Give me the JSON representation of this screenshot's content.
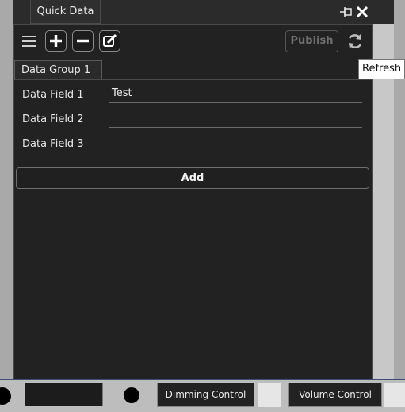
{
  "window": {
    "tab_title": "Quick Data",
    "pin_icon": "pin-icon",
    "close_icon": "close-icon"
  },
  "toolbar": {
    "menu_icon": "hamburger-menu-icon",
    "add_icon": "plus-icon",
    "remove_icon": "minus-icon",
    "edit_icon": "edit-icon",
    "publish_label": "Publish",
    "refresh_icon": "refresh-icon",
    "refresh_tooltip": "Refresh"
  },
  "group": {
    "tab_label": "Data Group 1"
  },
  "fields": [
    {
      "label": "Data Field 1",
      "value": "Test"
    },
    {
      "label": "Data Field 2",
      "value": ""
    },
    {
      "label": "Data Field 3",
      "value": ""
    }
  ],
  "add_label": "Add",
  "bottom_bar": {
    "dimming_label": "Dimming Control",
    "volume_label": "Volume Control"
  },
  "colors": {
    "panel_bg": "#222222",
    "accent_line": "#3c4f6e"
  }
}
